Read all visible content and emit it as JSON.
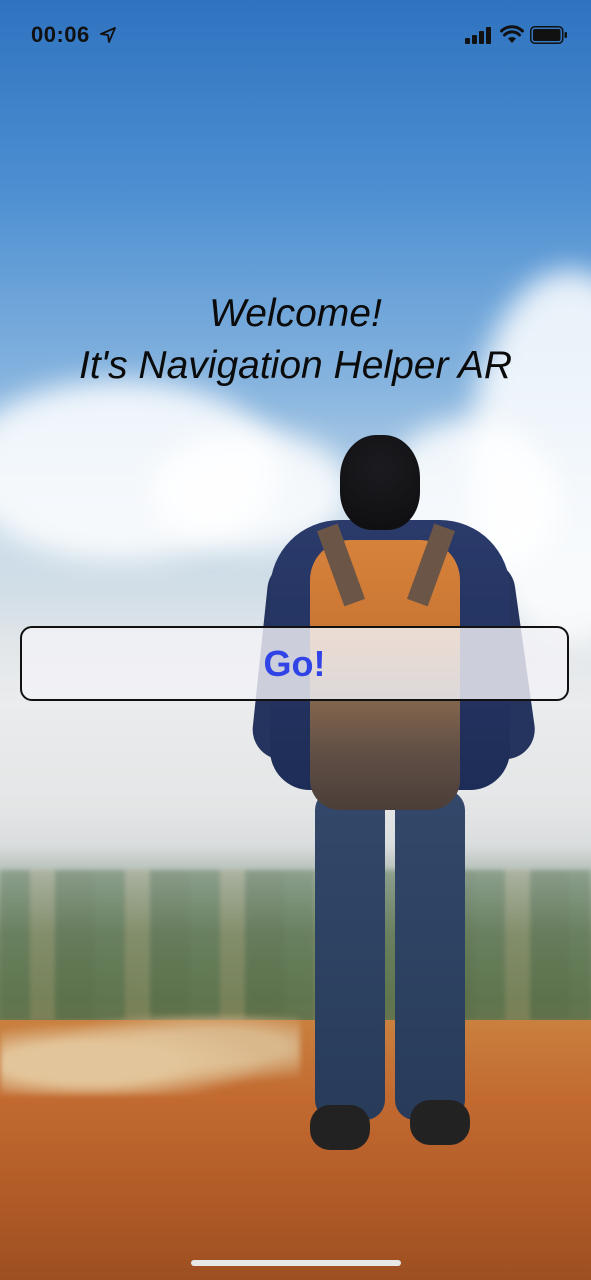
{
  "status_bar": {
    "time": "00:06",
    "icons": [
      "location-arrow-icon",
      "cellular-signal-icon",
      "wifi-icon",
      "battery-icon"
    ]
  },
  "welcome": {
    "line1": "Welcome!",
    "line2": "It's Navigation Helper AR"
  },
  "go_button": {
    "label": "Go!",
    "label_color": "#2f43e6"
  },
  "background": {
    "description_icon": "hiker-photo-background"
  }
}
